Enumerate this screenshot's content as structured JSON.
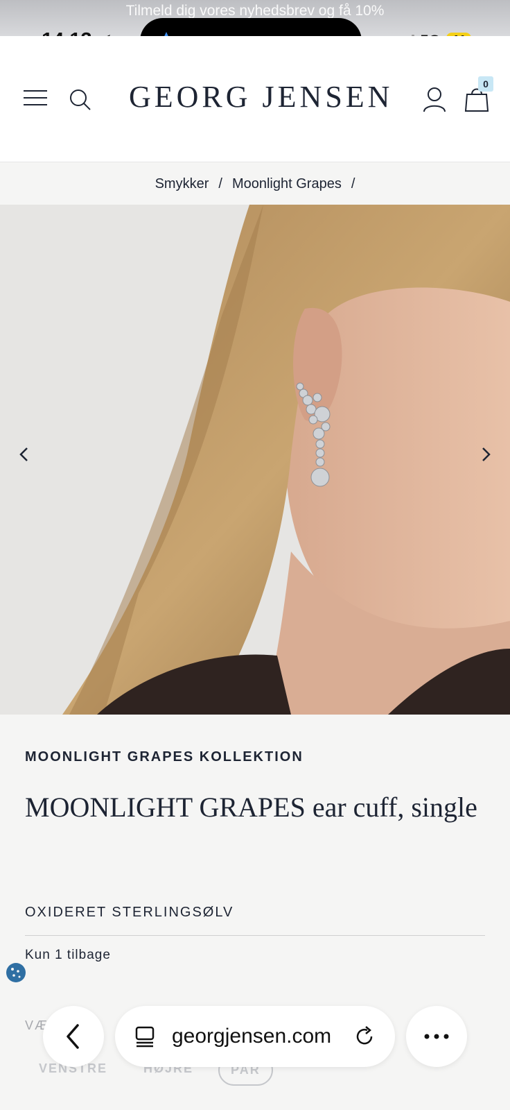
{
  "status_bar": {
    "banner": "Tilmeld dig vores nyhedsbrev og få 10%",
    "time": "14.13",
    "network": "5G",
    "battery": "41"
  },
  "header": {
    "logo": "GEORG JENSEN",
    "cart_count": "0"
  },
  "breadcrumb": {
    "items": [
      "Smykker",
      "Moonlight Grapes"
    ],
    "separator": "/"
  },
  "product": {
    "collection": "MOONLIGHT GRAPES KOLLEKTION",
    "title": "MOONLIGHT GRAPES ear cuff, single",
    "material": "OXIDERET STERLINGSØLV",
    "stock": "Kun 1 tilbage",
    "choose_label": "VÆLG TIL",
    "options": [
      "VENSTRE",
      "HØJRE",
      "PAR"
    ],
    "selected_option": "PAR"
  },
  "browser": {
    "url": "georgjensen.com"
  },
  "colors": {
    "text": "#1d2433",
    "background": "#f5f5f4",
    "cart_badge": "#c8e7f5"
  }
}
